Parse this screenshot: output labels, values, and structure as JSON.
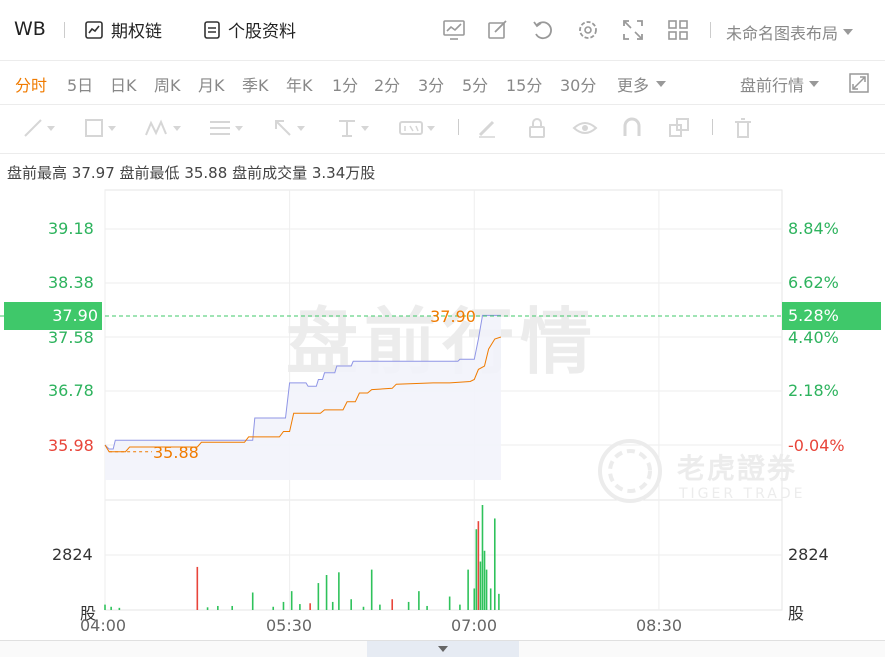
{
  "header": {
    "ticker": "WB",
    "options_chain": "期权链",
    "stock_profile": "个股资料",
    "layout_label": "未命名图表布局"
  },
  "periods": [
    "分时",
    "5日",
    "日K",
    "周K",
    "月K",
    "季K",
    "年K",
    "1分",
    "2分",
    "3分",
    "5分",
    "15分",
    "30分",
    "更多"
  ],
  "active_period": "分时",
  "session_select": "盘前行情",
  "stats": {
    "high_label": "盘前最高",
    "high": "37.97",
    "low_label": "盘前最低",
    "low": "35.88",
    "volume_label": "盘前成交量",
    "volume": "3.34万股"
  },
  "watermark": "盘前行情",
  "brand": {
    "name": "老虎證券",
    "sub": "TIGER TRADE"
  },
  "colors": {
    "up": "#2eb35e",
    "down": "#e8453a",
    "line": "#f07b00",
    "avg": "#8f95e6",
    "volume": "#2fc25b"
  },
  "chart_data": {
    "type": "line",
    "x_range": [
      "04:00",
      "09:30"
    ],
    "x_ticks": [
      "04:00",
      "05:30",
      "07:00",
      "08:30"
    ],
    "y_ticks_price": [
      "39.18",
      "38.38",
      "37.58",
      "36.78",
      "35.98"
    ],
    "y_ticks_pct": [
      "8.84%",
      "6.62%",
      "4.40%",
      "2.18%",
      "-0.04%"
    ],
    "ylim": [
      35.3,
      39.6
    ],
    "current_price": "37.90",
    "current_pct": "5.28%",
    "low_marker": "35.88",
    "vol_tick": "2824",
    "vol_unit": "股",
    "series": [
      {
        "name": "price",
        "points": [
          [
            "04:00",
            35.98
          ],
          [
            "04:02",
            35.88
          ],
          [
            "04:10",
            35.88
          ],
          [
            "04:12",
            35.95
          ],
          [
            "04:45",
            35.95
          ],
          [
            "04:47",
            36.02
          ],
          [
            "05:08",
            36.02
          ],
          [
            "05:10",
            36.1
          ],
          [
            "05:25",
            36.1
          ],
          [
            "05:27",
            36.18
          ],
          [
            "05:30",
            36.18
          ],
          [
            "05:32",
            36.45
          ],
          [
            "05:45",
            36.45
          ],
          [
            "05:47",
            36.5
          ],
          [
            "05:56",
            36.5
          ],
          [
            "05:58",
            36.62
          ],
          [
            "06:02",
            36.62
          ],
          [
            "06:04",
            36.75
          ],
          [
            "06:08",
            36.75
          ],
          [
            "06:10",
            36.8
          ],
          [
            "06:20",
            36.82
          ],
          [
            "06:22",
            36.88
          ],
          [
            "06:40",
            36.9
          ],
          [
            "06:48",
            36.9
          ],
          [
            "06:58",
            36.92
          ],
          [
            "07:00",
            36.95
          ],
          [
            "07:02",
            37.1
          ],
          [
            "07:05",
            37.15
          ],
          [
            "07:07",
            37.4
          ],
          [
            "07:10",
            37.55
          ],
          [
            "07:13",
            37.58
          ]
        ]
      },
      {
        "name": "average",
        "points": [
          [
            "04:00",
            35.98
          ],
          [
            "04:02",
            35.92
          ],
          [
            "04:04",
            35.92
          ],
          [
            "04:05",
            36.05
          ],
          [
            "05:12",
            36.05
          ],
          [
            "05:13",
            36.38
          ],
          [
            "05:28",
            36.38
          ],
          [
            "05:30",
            36.9
          ],
          [
            "05:38",
            36.9
          ],
          [
            "05:39",
            36.85
          ],
          [
            "05:43",
            36.85
          ],
          [
            "05:44",
            36.95
          ],
          [
            "05:46",
            36.95
          ],
          [
            "05:47",
            37.05
          ],
          [
            "05:52",
            37.05
          ],
          [
            "05:53",
            37.15
          ],
          [
            "06:00",
            37.15
          ],
          [
            "06:01",
            37.22
          ],
          [
            "06:52",
            37.22
          ],
          [
            "06:53",
            37.25
          ],
          [
            "07:00",
            37.25
          ],
          [
            "07:02",
            37.55
          ],
          [
            "07:04",
            37.9
          ],
          [
            "07:13",
            37.9
          ]
        ]
      }
    ],
    "volume_max": 3900,
    "volume": [
      [
        "04:00",
        200
      ],
      [
        "04:03",
        120
      ],
      [
        "04:07",
        80
      ],
      [
        "04:45",
        1600
      ],
      [
        "04:50",
        100
      ],
      [
        "04:55",
        150
      ],
      [
        "05:02",
        150
      ],
      [
        "05:12",
        650
      ],
      [
        "05:22",
        120
      ],
      [
        "05:27",
        300
      ],
      [
        "05:31",
        700
      ],
      [
        "05:35",
        220
      ],
      [
        "05:40",
        250
      ],
      [
        "05:44",
        1000
      ],
      [
        "05:48",
        1300
      ],
      [
        "05:51",
        300
      ],
      [
        "05:54",
        1400
      ],
      [
        "06:00",
        400
      ],
      [
        "06:06",
        120
      ],
      [
        "06:10",
        1500
      ],
      [
        "06:14",
        200
      ],
      [
        "06:20",
        400
      ],
      [
        "06:28",
        300
      ],
      [
        "06:33",
        700
      ],
      [
        "06:37",
        150
      ],
      [
        "06:48",
        500
      ],
      [
        "06:53",
        200
      ],
      [
        "06:57",
        1500
      ],
      [
        "07:00",
        800
      ],
      [
        "07:01",
        3000
      ],
      [
        "07:02",
        3300
      ],
      [
        "07:03",
        1800
      ],
      [
        "07:04",
        3900
      ],
      [
        "07:05",
        2200
      ],
      [
        "07:06",
        1500
      ],
      [
        "07:08",
        800
      ],
      [
        "07:10",
        3400
      ],
      [
        "07:12",
        600
      ]
    ]
  }
}
